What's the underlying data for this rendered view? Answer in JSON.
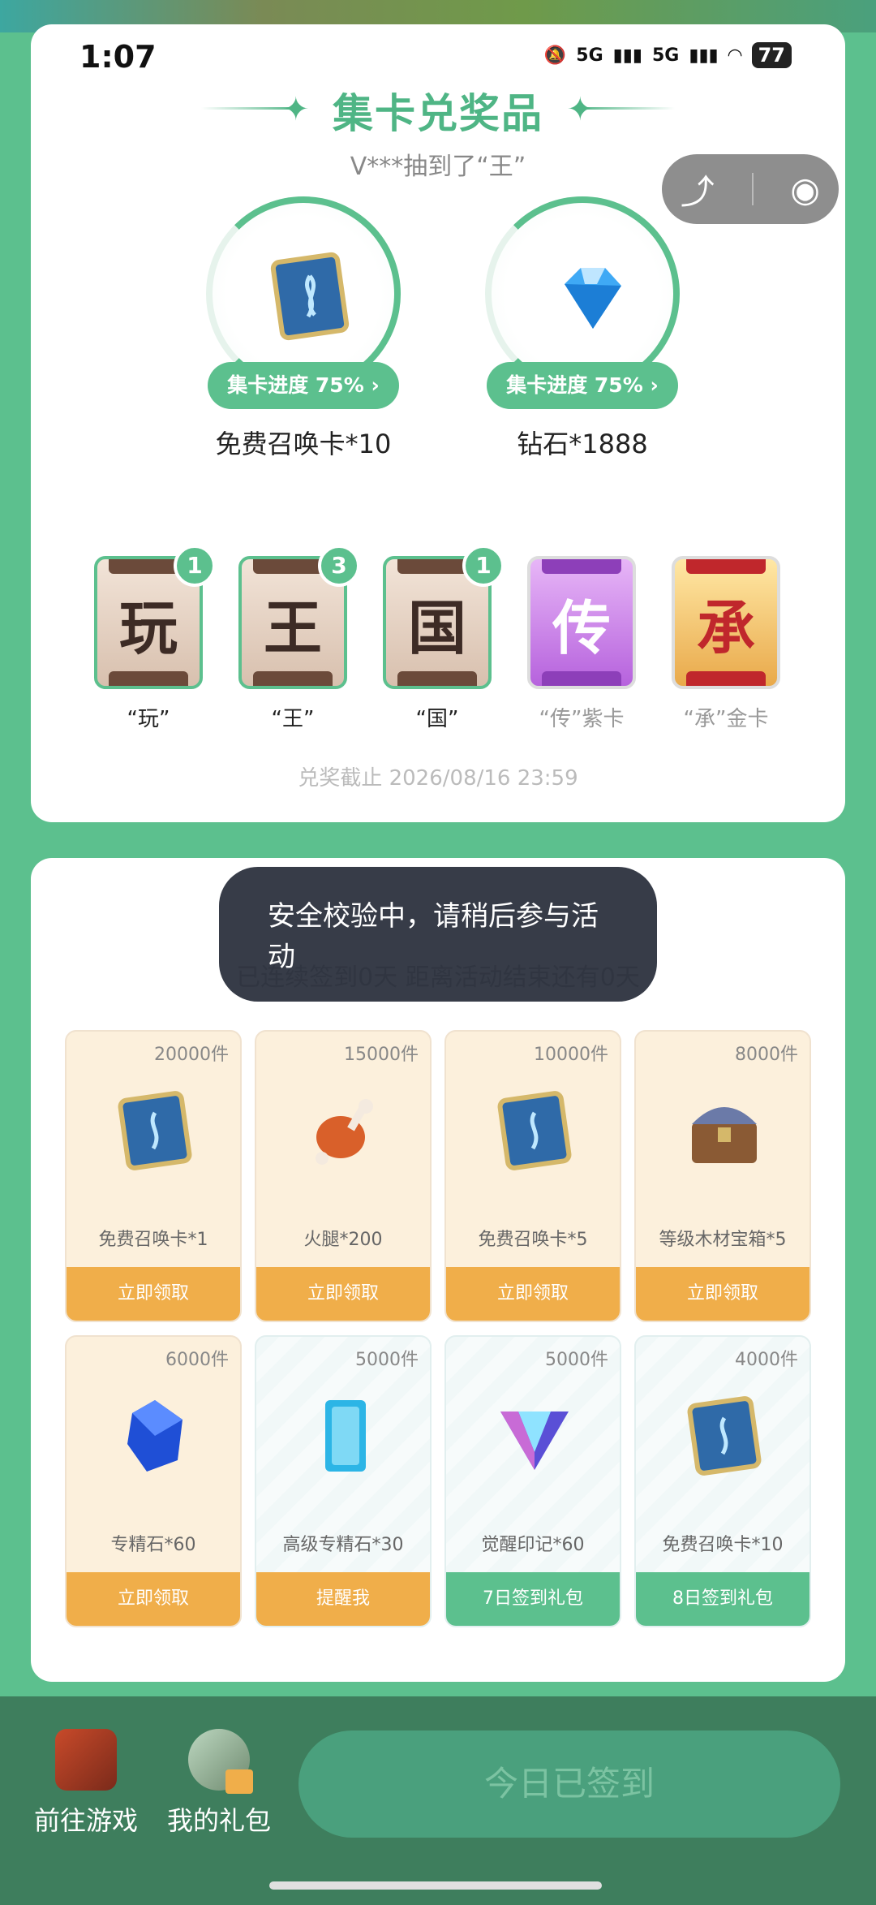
{
  "status": {
    "time": "1:07",
    "network1": "5G",
    "network2": "5G",
    "battery": "77"
  },
  "header": {
    "title": "集卡兑奖品",
    "subtitle": "V***抽到了“王”"
  },
  "prizes": [
    {
      "progress_label": "集卡进度 75%",
      "progress": 0.75,
      "name": "免费召唤卡*10",
      "icon": "summon-card-icon"
    },
    {
      "progress_label": "集卡进度 75%",
      "progress": 0.75,
      "name": "钻石*1888",
      "icon": "diamond-icon"
    }
  ],
  "cards": [
    {
      "char": "玩",
      "count": "1",
      "label": "“玩”"
    },
    {
      "char": "王",
      "count": "3",
      "label": "“王”"
    },
    {
      "char": "国",
      "count": "1",
      "label": "“国”"
    },
    {
      "char": "传",
      "count": "",
      "label": "“传”紫卡"
    },
    {
      "char": "承",
      "count": "",
      "label": "“承”金卡"
    }
  ],
  "deadline": "兑奖截止 2026/08/16 23:59",
  "section2": {
    "title": "",
    "subtitle": "已连续签到0天 距离活动结束还有0天"
  },
  "toast": "安全校验中，请稍后参与活动",
  "items": [
    {
      "stock": "20000件",
      "name": "免费召唤卡*1",
      "button": "立即领取",
      "icon": "summon-card-icon"
    },
    {
      "stock": "15000件",
      "name": "火腿*200",
      "button": "立即领取",
      "icon": "ham-icon"
    },
    {
      "stock": "10000件",
      "name": "免费召唤卡*5",
      "button": "立即领取",
      "icon": "summon-card-icon"
    },
    {
      "stock": "8000件",
      "name": "等级木材宝箱*5",
      "button": "立即领取",
      "icon": "treasure-chest-icon"
    },
    {
      "stock": "6000件",
      "name": "专精石*60",
      "button": "立即领取",
      "icon": "blue-gem-icon"
    },
    {
      "stock": "5000件",
      "name": "高级专精石*30",
      "button": "提醒我",
      "icon": "crystal-block-icon"
    },
    {
      "stock": "5000件",
      "name": "觉醒印记*60",
      "button": "7日签到礼包",
      "icon": "awaken-mark-icon"
    },
    {
      "stock": "4000件",
      "name": "免费召唤卡*10",
      "button": "8日签到礼包",
      "icon": "summon-card-icon"
    }
  ],
  "bottom": {
    "go_game": "前往游戏",
    "my_gifts": "我的礼包",
    "signed": "今日已签到"
  },
  "colors": {
    "accent": "#5cc08e",
    "orange": "#f0ae4a",
    "bar": "#3e7e5d"
  }
}
